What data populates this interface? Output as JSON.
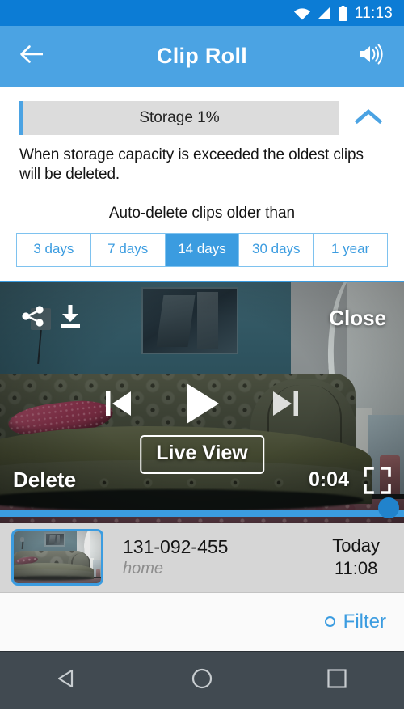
{
  "status_bar": {
    "time": "11:13",
    "icons": [
      "wifi-icon",
      "signal-icon",
      "battery-icon"
    ],
    "background": "#0c7cd5"
  },
  "app_bar": {
    "title": "Clip Roll",
    "back_icon": "back-arrow-icon",
    "volume_icon": "volume-icon",
    "background": "#4ba3e3"
  },
  "storage": {
    "label": "Storage 1%",
    "percent": 1,
    "collapse_icon": "chevron-up-icon",
    "description": "When storage capacity is exceeded the oldest clips will be deleted.",
    "fill_color": "#4ba3e3",
    "track_color": "#dcdcdc"
  },
  "auto_delete": {
    "title": "Auto-delete clips older than",
    "options": [
      {
        "label": "3 days",
        "selected": false
      },
      {
        "label": "7 days",
        "selected": false
      },
      {
        "label": "14 days",
        "selected": true
      },
      {
        "label": "30 days",
        "selected": false
      },
      {
        "label": "1 year",
        "selected": false
      }
    ],
    "accent": "#3b9ce0"
  },
  "player": {
    "share_icon": "share-icon",
    "download_icon": "download-icon",
    "close_label": "Close",
    "prev_icon": "skip-previous-icon",
    "play_icon": "play-icon",
    "next_icon": "skip-next-icon",
    "live_view_label": "Live View",
    "delete_label": "Delete",
    "time_label": "0:04",
    "fullscreen_icon": "fullscreen-icon",
    "progress_percent": 100,
    "progress_color": "#3b9ce0"
  },
  "clips": [
    {
      "thumbnail": "clip-thumbnail",
      "name": "131-092-455",
      "location": "home",
      "day": "Today",
      "time": "11:08"
    }
  ],
  "filter": {
    "label": "Filter",
    "icon": "circle-outline-icon",
    "color": "#3b9ce0"
  },
  "nav_bar": {
    "back_icon": "nav-back-icon",
    "home_icon": "nav-home-icon",
    "recents_icon": "nav-recents-icon",
    "background": "#414a51"
  }
}
